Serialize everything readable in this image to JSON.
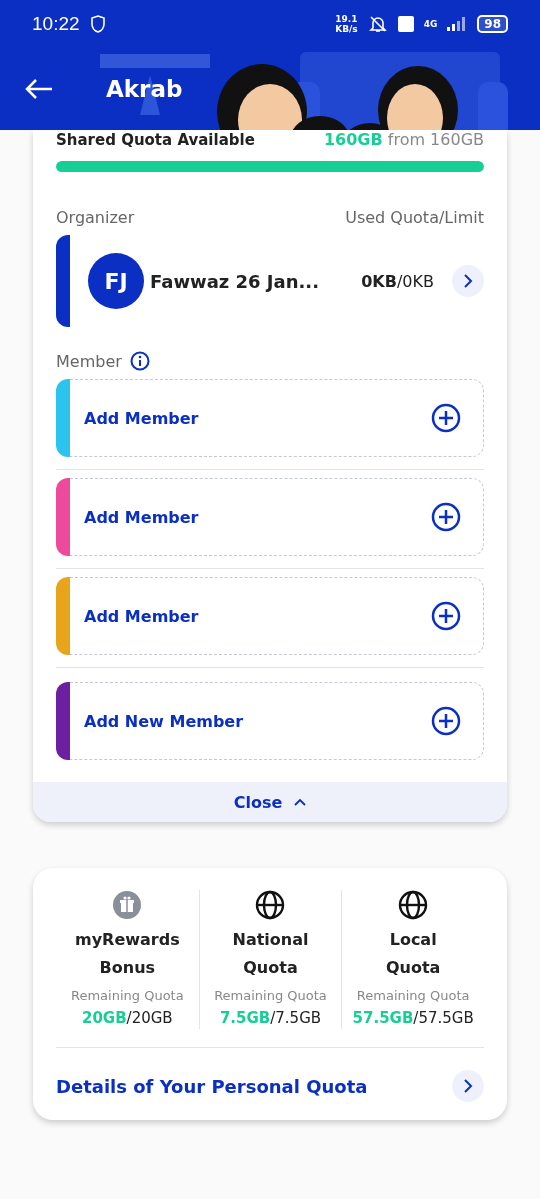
{
  "status_bar": {
    "time": "10:22",
    "speed_value": "19.1",
    "speed_unit": "KB/s",
    "network": "4G",
    "battery": "98"
  },
  "header": {
    "title": "Akrab"
  },
  "shared_quota": {
    "label": "Shared Quota Available",
    "amount": "160GB",
    "total": "from 160GB",
    "level": 1
  },
  "organizer": {
    "label": "Organizer",
    "column": "Used Quota/Limit",
    "initials": "FJ",
    "name": "Fawwaz 26 Jan...",
    "used": "0KB",
    "limit": "/0KB"
  },
  "members": {
    "label": "Member",
    "items": [
      {
        "label": "Add Member",
        "color": "#2bc4ee"
      },
      {
        "label": "Add Member",
        "color": "#ee4a9c"
      },
      {
        "label": "Add Member",
        "color": "#e8a41a"
      },
      {
        "label": "Add New Member",
        "color": "#6c1fa0"
      }
    ]
  },
  "close_button": {
    "label": "Close"
  },
  "personal_quota": {
    "items": [
      {
        "kind": "gift",
        "title": "myRewards Bonus",
        "caption": "Remaining Quota",
        "remaining": "20GB",
        "total": "/20GB"
      },
      {
        "kind": "globe",
        "title": "National Quota",
        "caption": "Remaining Quota",
        "remaining": "7.5GB",
        "total": "/7.5GB"
      },
      {
        "kind": "globe",
        "title": "Local Quota",
        "caption": "Remaining Quota",
        "remaining": "57.5GB",
        "total": "/57.5GB"
      }
    ],
    "details_link": "Details of Your Personal Quota"
  }
}
